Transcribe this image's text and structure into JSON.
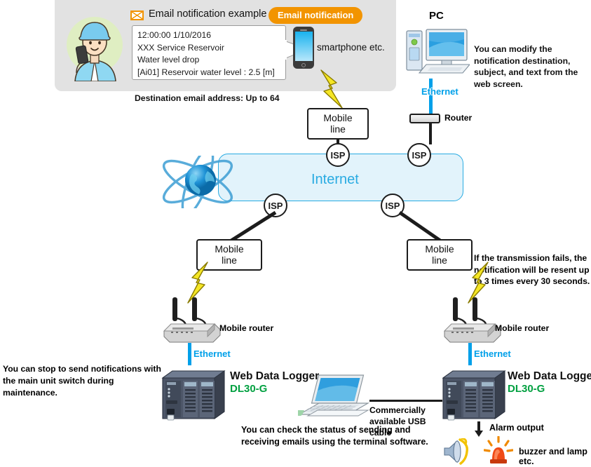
{
  "panel": {
    "email_example_label": "Email notification example",
    "email_notification_badge": "Email notification",
    "envelope_icon": "envelope-icon",
    "worker_icon": "worker-avatar-icon",
    "email_body": {
      "line1": "12:00:00 1/10/2016",
      "line2": "XXX Service Reservoir",
      "line3": "Water level drop",
      "line4": "[Ai01] Reservoir water level : 2.5 [m]"
    },
    "smartphone_label": "smartphone etc.",
    "destination_note": "Destination email address: Up to 64"
  },
  "pc": {
    "title": "PC",
    "note": "You can modify the notification destination, subject, and text from the web screen.",
    "ethernet_label": "Ethernet",
    "router_label": "Router"
  },
  "internet": {
    "label": "Internet",
    "globe_icon": "globe-icon",
    "isp_label": "ISP",
    "isp_nodes": [
      "ISP",
      "ISP",
      "ISP",
      "ISP"
    ]
  },
  "mobile_lines": {
    "top": "Mobile line",
    "left": "Mobile line",
    "right": "Mobile line"
  },
  "sites": {
    "left": {
      "mobile_router_label": "Mobile router",
      "ethernet_label": "Ethernet",
      "logger_title": "Web Data Logger",
      "logger_model": "DL30-G"
    },
    "right": {
      "mobile_router_label": "Mobile router",
      "ethernet_label": "Ethernet",
      "logger_title": "Web Data Logger",
      "logger_model": "DL30-G"
    }
  },
  "notes": {
    "maintenance": "You can stop to send notifications with the main unit switch during maintenance.",
    "resend": "If the transmission fails, the notification will be resent up to 3 times every 30 seconds.",
    "usb_cable": "Commercially available USB cable",
    "terminal": "You can check the status of sending and receiving emails using the terminal software."
  },
  "alarm": {
    "output_label": "Alarm output",
    "devices_label": "buzzer and lamp etc.",
    "speaker_icon": "speaker-icon",
    "lamp_icon": "warning-lamp-icon",
    "arrow_icon": "down-arrow-icon"
  },
  "colors": {
    "panel_bg": "#e2e2e2",
    "badge_orange": "#f29400",
    "ethernet_blue": "#00a0e9",
    "cloud_bg": "#e2f3fb",
    "cloud_border": "#29abe2",
    "internet_text": "#29abe2",
    "model_green": "#00a040",
    "bolt_yellow": "#f5e625",
    "line_black": "#1c1c1c"
  }
}
